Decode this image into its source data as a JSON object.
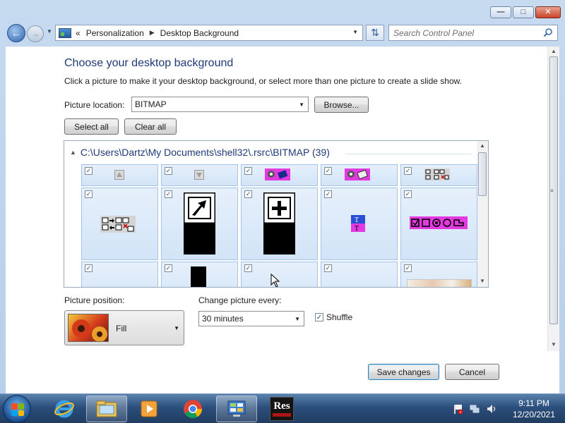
{
  "window": {
    "caption_buttons": [
      "minimize",
      "maximize",
      "close"
    ]
  },
  "nav": {
    "breadcrumb_chevron": "«",
    "breadcrumb": [
      "Personalization",
      "Desktop Background"
    ],
    "search_placeholder": "Search Control Panel"
  },
  "page": {
    "heading": "Choose your desktop background",
    "description": "Click a picture to make it your desktop background, or select more than one picture to create a slide show.",
    "picture_location_label": "Picture location:",
    "picture_location_value": "BITMAP",
    "browse_label": "Browse...",
    "select_all_label": "Select all",
    "clear_all_label": "Clear all"
  },
  "gallery": {
    "group_title": "C:\\Users\\Dartz\\My Documents\\shell32\\.rsrc\\BITMAP (39)",
    "tiles": [
      {
        "checked": true,
        "icon": "up-arrow-bitmap"
      },
      {
        "checked": true,
        "icon": "down-arrow-bitmap"
      },
      {
        "checked": true,
        "icon": "magenta-toolbar-bitmap"
      },
      {
        "checked": true,
        "icon": "magenta-toolbar-bitmap"
      },
      {
        "checked": true,
        "icon": "copy-move-bitmap"
      },
      {
        "checked": true,
        "icon": "copy-move-bitmap"
      },
      {
        "checked": true,
        "icon": "shortcut-arrow-bitmap"
      },
      {
        "checked": true,
        "icon": "plus-overlay-bitmap"
      },
      {
        "checked": true,
        "icon": "text-tool-bitmap"
      },
      {
        "checked": true,
        "icon": "shape-tools-bitmap"
      },
      {
        "checked": true,
        "icon": "blank-bitmap"
      },
      {
        "checked": true,
        "icon": "black-bar-bitmap"
      },
      {
        "checked": true,
        "icon": "blank-bitmap"
      },
      {
        "checked": true,
        "icon": "blank-bitmap"
      },
      {
        "checked": true,
        "icon": "landscape-bitmap"
      }
    ]
  },
  "options": {
    "position_label": "Picture position:",
    "position_value": "Fill",
    "interval_label": "Change picture every:",
    "interval_value": "30 minutes",
    "shuffle_label": "Shuffle",
    "shuffle_checked": true
  },
  "footer": {
    "save_label": "Save changes",
    "cancel_label": "Cancel"
  },
  "taskbar": {
    "items": [
      "internet-explorer-icon",
      "windows-explorer-icon",
      "media-player-icon",
      "chrome-icon",
      "control-panel-icon",
      "resource-hacker-icon"
    ],
    "reshacker_text": "Res",
    "time": "9:11 PM",
    "date": "12/20/2021"
  },
  "colors": {
    "heading": "#1e3a78",
    "tile_bg": "#d9e8f8",
    "magenta": "#e23ae0"
  }
}
